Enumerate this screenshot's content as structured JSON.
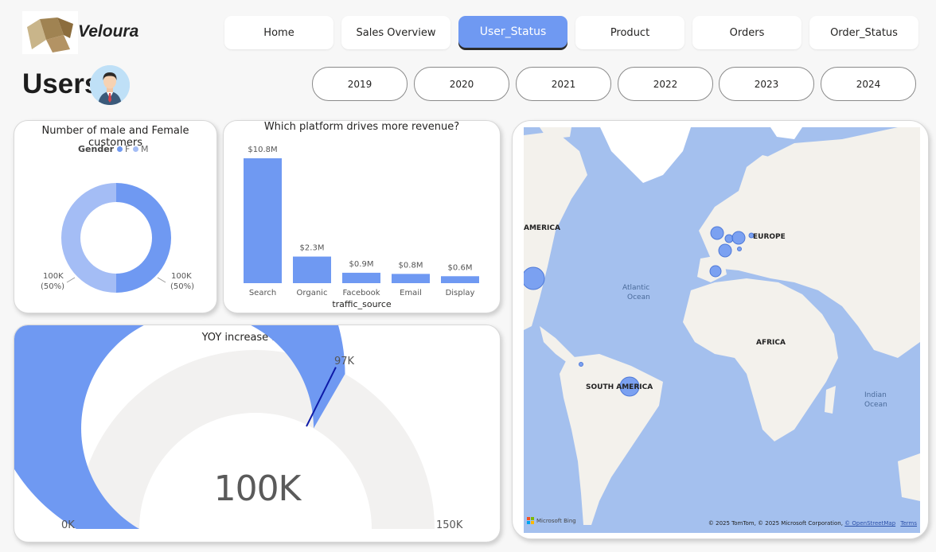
{
  "brand": {
    "name": "Veloura"
  },
  "nav": {
    "tabs": [
      {
        "label": "Home"
      },
      {
        "label": "Sales Overview"
      },
      {
        "label": "User_Status"
      },
      {
        "label": "Product"
      },
      {
        "label": "Orders"
      },
      {
        "label": "Order_Status"
      }
    ],
    "active_index": 2
  },
  "page": {
    "title": "Users"
  },
  "year_filter": {
    "years": [
      "2019",
      "2020",
      "2021",
      "2022",
      "2023",
      "2024"
    ]
  },
  "gender_card": {
    "title": "Number of male and Female customers",
    "legend_title": "Gender",
    "legend": [
      {
        "label": "F",
        "color": "#6f99f2"
      },
      {
        "label": "M",
        "color": "#a4bdf5"
      }
    ],
    "left_label": "100K",
    "left_pct": "(50%)",
    "right_label": "100K",
    "right_pct": "(50%)"
  },
  "platform_card": {
    "title": "Which platform drives more revenue?",
    "xlabel": "traffic_source"
  },
  "yoy_card": {
    "title": "YOY increase in users",
    "min_label": "0K",
    "max_label": "150K",
    "target_label": "97K",
    "value_label": "100K"
  },
  "map_card": {
    "labels": {
      "america": "AMERICA",
      "europe": "EUROPE",
      "atlantic1": "Atlantic",
      "atlantic2": "Ocean",
      "africa": "AFRICA",
      "south_america": "SOUTH AMERICA",
      "indian1": "Indian",
      "indian2": "Ocean"
    },
    "bing": "Microsoft Bing",
    "attribution": "© 2025 TomTom, © 2025 Microsoft Corporation,",
    "osm": "© OpenStreetMap",
    "terms": "Terms"
  },
  "colors": {
    "accent": "#6f99f2",
    "accent_light": "#a4bdf5",
    "gauge_bg": "#f2f1f0",
    "target_line": "#0d1aa8",
    "map_water": "#a4c0ee",
    "land": "#f3f1ec"
  },
  "chart_data": [
    {
      "type": "pie",
      "title": "Number of male and Female customers",
      "categories": [
        "F",
        "M"
      ],
      "values": [
        100000,
        100000
      ],
      "percent": [
        50,
        50
      ]
    },
    {
      "type": "bar",
      "title": "Which platform drives more revenue?",
      "xlabel": "traffic_source",
      "ylabel": "",
      "categories": [
        "Search",
        "Organic",
        "Facebook",
        "Email",
        "Display"
      ],
      "values": [
        10.8,
        2.3,
        0.9,
        0.8,
        0.6
      ],
      "data_labels": [
        "$10.8M",
        "$2.3M",
        "$0.9M",
        "$0.8M",
        "$0.6M"
      ],
      "ylim": [
        0,
        10.8
      ]
    },
    {
      "type": "gauge",
      "title": "YOY increase in users",
      "value": 100000,
      "min": 0,
      "max": 150000,
      "target": 97000
    }
  ]
}
